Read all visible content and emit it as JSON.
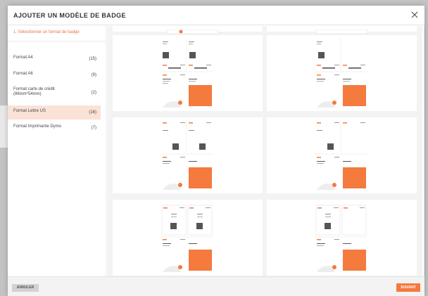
{
  "modal": {
    "title": "AJOUTER UN MODÈLE DE BADGE",
    "close_icon": "close-icon"
  },
  "sidebar": {
    "step_label": "1. Sélectionner un format de badge",
    "formats": [
      {
        "label": "Format A4",
        "count": "(15)",
        "active": false
      },
      {
        "label": "Format A6",
        "count": "(9)",
        "active": false
      },
      {
        "label": "Format carte de crédit (86mm*54mm)",
        "count": "(2)",
        "active": false
      },
      {
        "label": "Format Lettre US",
        "count": "(16)",
        "active": true
      },
      {
        "label": "Format Imprimante Dymo",
        "count": "(7)",
        "active": false
      }
    ]
  },
  "footer": {
    "cancel_label": "ANNULER",
    "next_label": "SUIVANT"
  },
  "colors": {
    "accent": "#f47a3e",
    "active_bg": "#fbe2d6",
    "step_text": "#f07040"
  }
}
